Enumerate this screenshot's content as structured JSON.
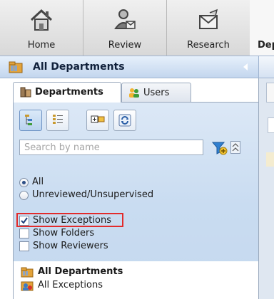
{
  "topnav": {
    "items": [
      {
        "label": "Home",
        "icon": "home-icon"
      },
      {
        "label": "Review",
        "icon": "review-icon"
      },
      {
        "label": "Research",
        "icon": "research-icon"
      },
      {
        "label": "Dep",
        "icon": ""
      }
    ]
  },
  "deptbar": {
    "title": "All Departments",
    "icon": "folder-icon"
  },
  "tabs": [
    {
      "label": "Departments",
      "icon": "departments-icon",
      "active": true
    },
    {
      "label": "Users",
      "icon": "users-icon",
      "active": false
    }
  ],
  "toolbar": {
    "buttons": [
      "tree-view-icon",
      "list-view-icon",
      "expand-collapse-icon",
      "refresh-icon"
    ]
  },
  "search": {
    "placeholder": "Search by name"
  },
  "filters": {
    "radios": [
      {
        "label": "All",
        "checked": true
      },
      {
        "label": "Unreviewed/Unsupervised",
        "checked": false
      }
    ],
    "checks": [
      {
        "label": "Show Exceptions",
        "checked": true
      },
      {
        "label": "Show Folders",
        "checked": false
      },
      {
        "label": "Show Reviewers",
        "checked": false
      }
    ]
  },
  "tree": {
    "nodes": [
      {
        "label": "All Departments",
        "icon": "folder-icon"
      },
      {
        "label": "All Exceptions",
        "icon": "exceptions-icon"
      }
    ]
  },
  "colors": {
    "accent": "#c6d9ef",
    "highlight": "#e22b2b"
  }
}
